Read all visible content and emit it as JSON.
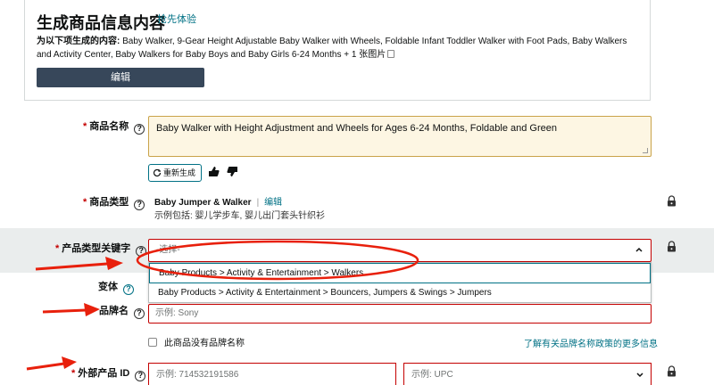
{
  "gen": {
    "title": "生成商品信息内容",
    "badge": "抢先体验",
    "desc_prefix": "为以下项生成的内容:",
    "desc_text": "Baby Walker, 9-Gear Height Adjustable Baby Walker with Wheels, Foldable Infant Toddler Walker with Foot Pads, Baby Walkers and Activity Center, Baby Walkers for Baby Boys and Baby Girls 6-24 Months",
    "desc_suffix": "+ 1 张图片",
    "edit_button": "编辑"
  },
  "product_name": {
    "label": "商品名称",
    "value": "Baby Walker with Height Adjustment and Wheels for Ages 6-24 Months, Foldable and Green",
    "regenerate": "重新生成"
  },
  "product_type": {
    "label": "商品类型",
    "value": "Baby Jumper & Walker",
    "edit": "编辑",
    "example": "示例包括: 婴儿学步车, 婴儿出门套头针织衫"
  },
  "keyword": {
    "label": "产品类型关键字",
    "placeholder": "-选择-",
    "options": [
      "Baby Products > Activity & Entertainment > Walkers",
      "Baby Products > Activity & Entertainment > Bouncers, Jumpers & Swings > Jumpers"
    ]
  },
  "variant": {
    "label": "变体"
  },
  "brand": {
    "label": "品牌名",
    "placeholder": "示例: Sony",
    "no_brand": "此商品没有品牌名称",
    "policy_link": "了解有关品牌名称政策的更多信息"
  },
  "external_id": {
    "label": "外部产品 ID",
    "placeholder": "示例: 714532191586",
    "type_placeholder": "示例: UPC"
  },
  "colors": {
    "link": "#007185",
    "required": "#c40000",
    "annotation": "#e8200c",
    "button": "#37475a"
  }
}
